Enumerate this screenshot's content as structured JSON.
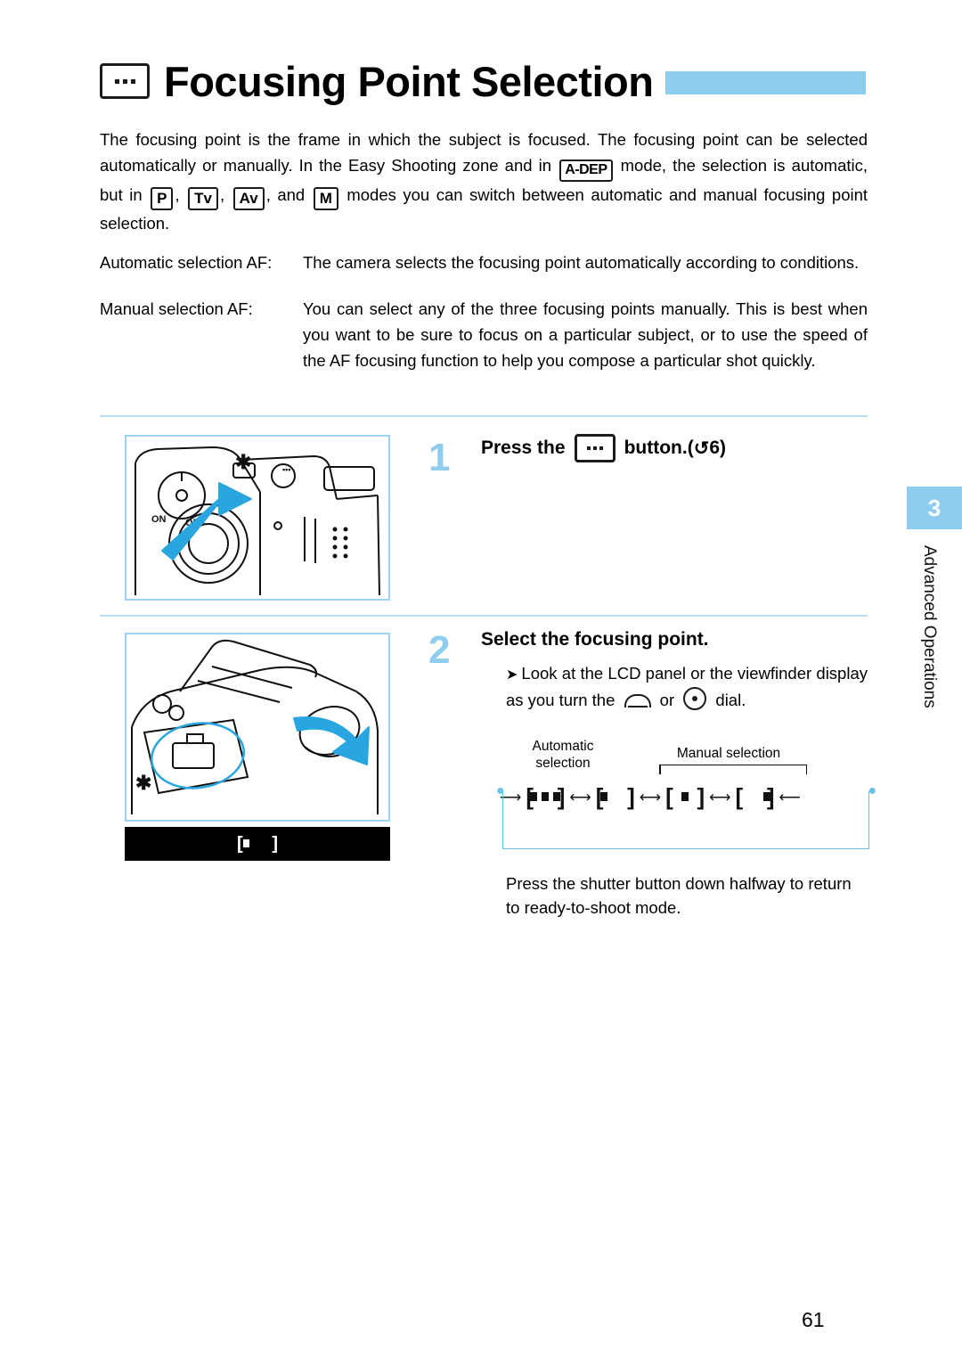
{
  "title": {
    "text": "Focusing Point Selection",
    "icon": "af-point-button-icon"
  },
  "intro": {
    "part1": "The focusing point is the frame in which the subject is focused. The focusing point can be selected automatically or manually. In the Easy Shooting zone and in",
    "mode_adep": "A-DEP",
    "part2": "mode, the selection is automatic, but in",
    "mode_p": "P",
    "comma1": ",",
    "mode_tv": "Tv",
    "comma2": ",",
    "mode_av": "Av",
    "and": ", and",
    "mode_m": "M",
    "part3": "modes you can switch between automatic and manual focusing point selection."
  },
  "definitions": [
    {
      "term": "Automatic selection AF:",
      "desc": "The camera selects the focusing point automatically according to conditions."
    },
    {
      "term": "Manual selection AF:",
      "desc": "You can select any of the three focusing points manually. This is best when you want to be sure to focus on a particular subject, or to use the speed of the AF focusing function to help you compose a particular shot quickly."
    }
  ],
  "step1": {
    "number": "1",
    "label_before": "Press the",
    "label_after": "button.",
    "timer_open": "(",
    "timer_symbol": "↺",
    "timer_value": "6",
    "timer_close": ")"
  },
  "step2": {
    "number": "2",
    "heading": "Select the focusing point.",
    "body": "Look at the LCD panel or the viewfinder display as you turn the",
    "body_or": "or",
    "body_end": "dial.",
    "diagram": {
      "label_auto": "Automatic selection",
      "label_manual": "Manual selection",
      "sequence": [
        "auto-all-points",
        "left-point",
        "center-point",
        "right-point"
      ]
    },
    "closing": "Press the shutter button down halfway to return to ready-to-shoot mode."
  },
  "figures": {
    "fig1_caption": "camera-top-with-af-button-illustration",
    "fig2_caption": "camera-rear-with-dial-illustration",
    "lcd_panel": "lcd-panel-af-point-display"
  },
  "side": {
    "chapter_number": "3",
    "chapter_label": "Advanced Operations"
  },
  "page_number": "61",
  "colors": {
    "accent": "#8ecdf0",
    "rule": "#b9dff2",
    "figure_border": "#9cd4ef"
  }
}
